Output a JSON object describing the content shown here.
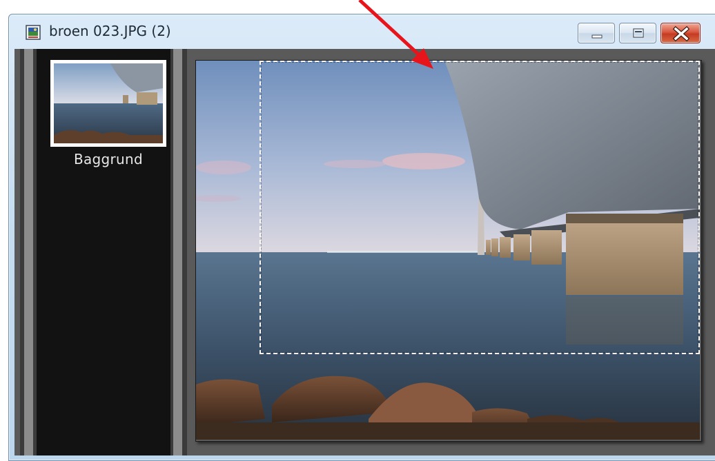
{
  "window": {
    "title": "broen 023.JPG (2)",
    "icon": "image-document-icon",
    "controls": [
      "minimize-icon",
      "maximize-icon",
      "close-icon"
    ]
  },
  "layers": {
    "items": [
      {
        "label": "Baggrund",
        "icon": "layer-thumbnail"
      }
    ]
  },
  "canvas": {
    "selection": "dashed-marquee"
  },
  "annotation": {
    "arrow_color": "#e8141b"
  },
  "colors": {
    "titlebar": "#c8def1",
    "filmstrip": "#121212",
    "close_button": "#c53b21"
  }
}
